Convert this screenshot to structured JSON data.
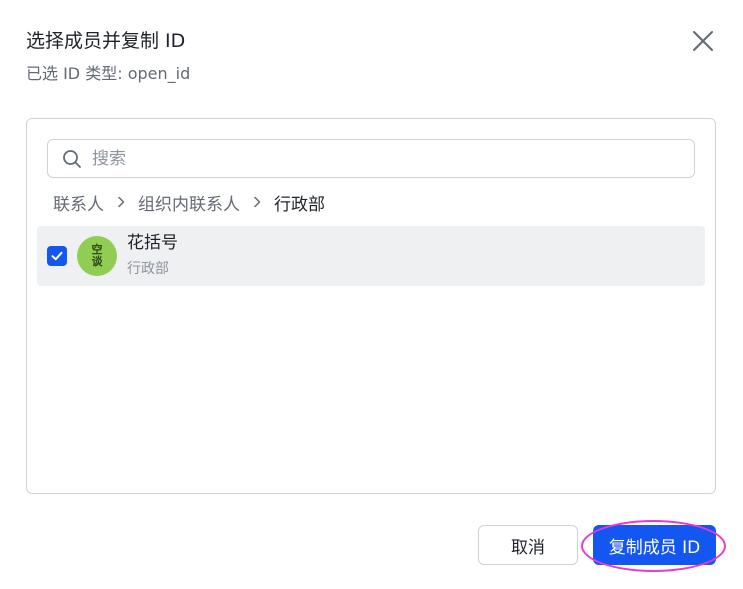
{
  "dialog": {
    "title": "选择成员并复制 ID",
    "subtitle": "已选 ID 类型: open_id"
  },
  "search": {
    "placeholder": "搜索",
    "value": ""
  },
  "breadcrumb": [
    "联系人",
    "组织内联系人",
    "行政部"
  ],
  "members": [
    {
      "name": "花括号",
      "department": "行政部",
      "avatar_text": [
        "空",
        "谈"
      ],
      "avatar_color": "#8fce52",
      "checked": true
    }
  ],
  "buttons": {
    "cancel_label": "取消",
    "confirm_label": "复制成员 ID"
  },
  "colors": {
    "primary": "#1456f0",
    "highlight": "#e53ae0",
    "row_selected_bg": "#eff0f1"
  }
}
